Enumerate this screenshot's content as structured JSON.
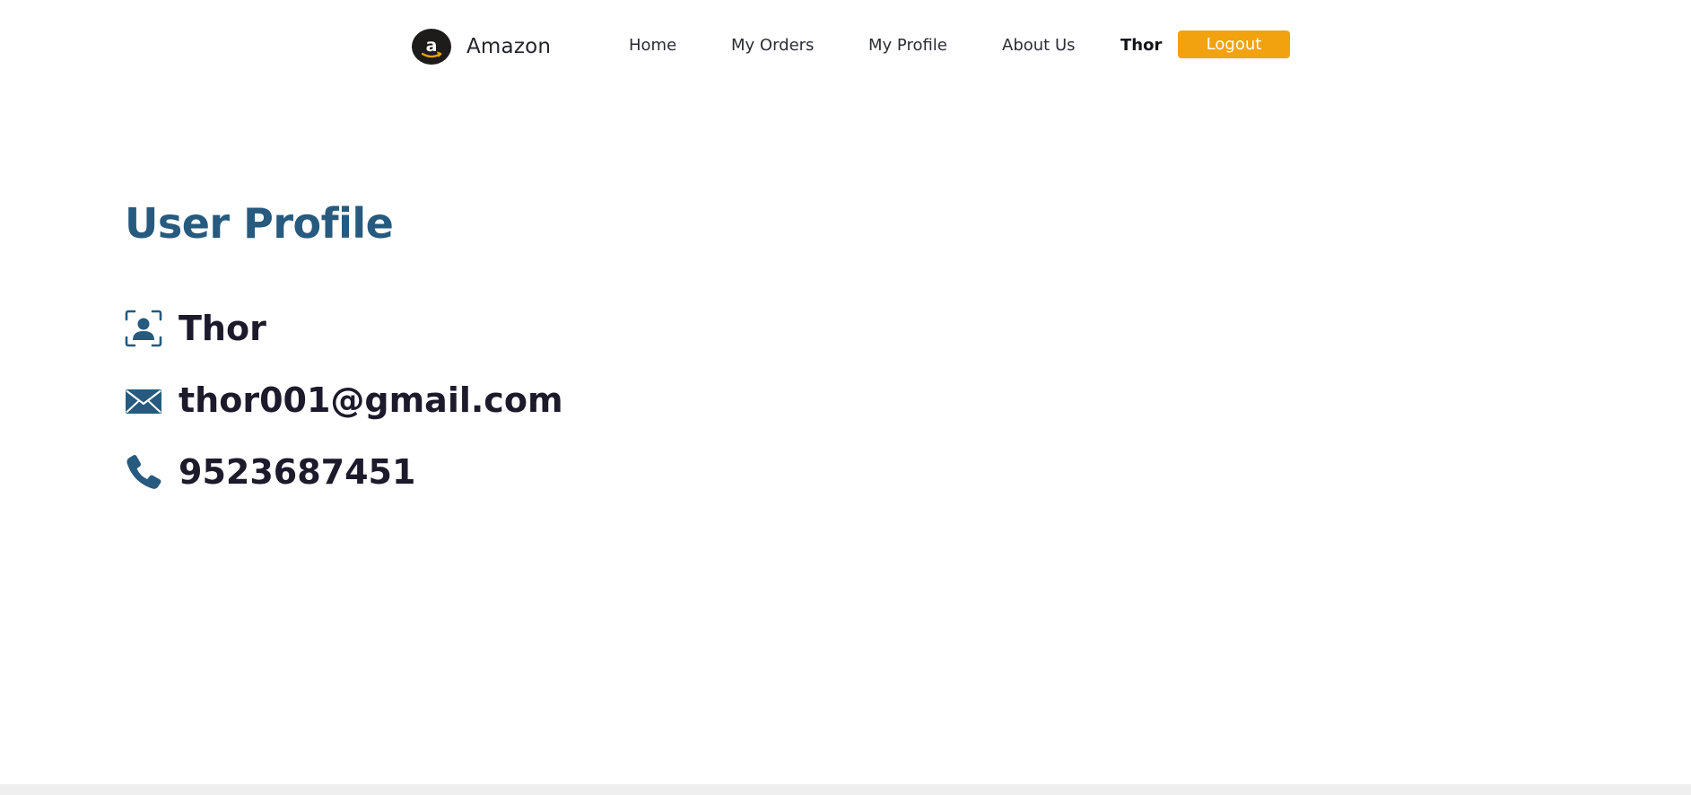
{
  "navbar": {
    "brand_logo_letter": "a",
    "brand_name": "Amazon",
    "links": {
      "home": "Home",
      "orders": "My Orders",
      "profile": "My Profile",
      "about": "About Us"
    },
    "current_user": "Thor",
    "logout_label": "Logout"
  },
  "profile": {
    "title": "User Profile",
    "name": "Thor",
    "email": "thor001@gmail.com",
    "phone": "9523687451",
    "icons": {
      "name": "user-id-icon",
      "email": "envelope-icon",
      "phone": "phone-icon"
    }
  },
  "colors": {
    "accent": "#f2a20f",
    "title": "#265a7e",
    "icon": "#265a7e",
    "text": "#1c1a2b",
    "logo_bg": "#1e1b1b",
    "footer": "#efefef"
  }
}
